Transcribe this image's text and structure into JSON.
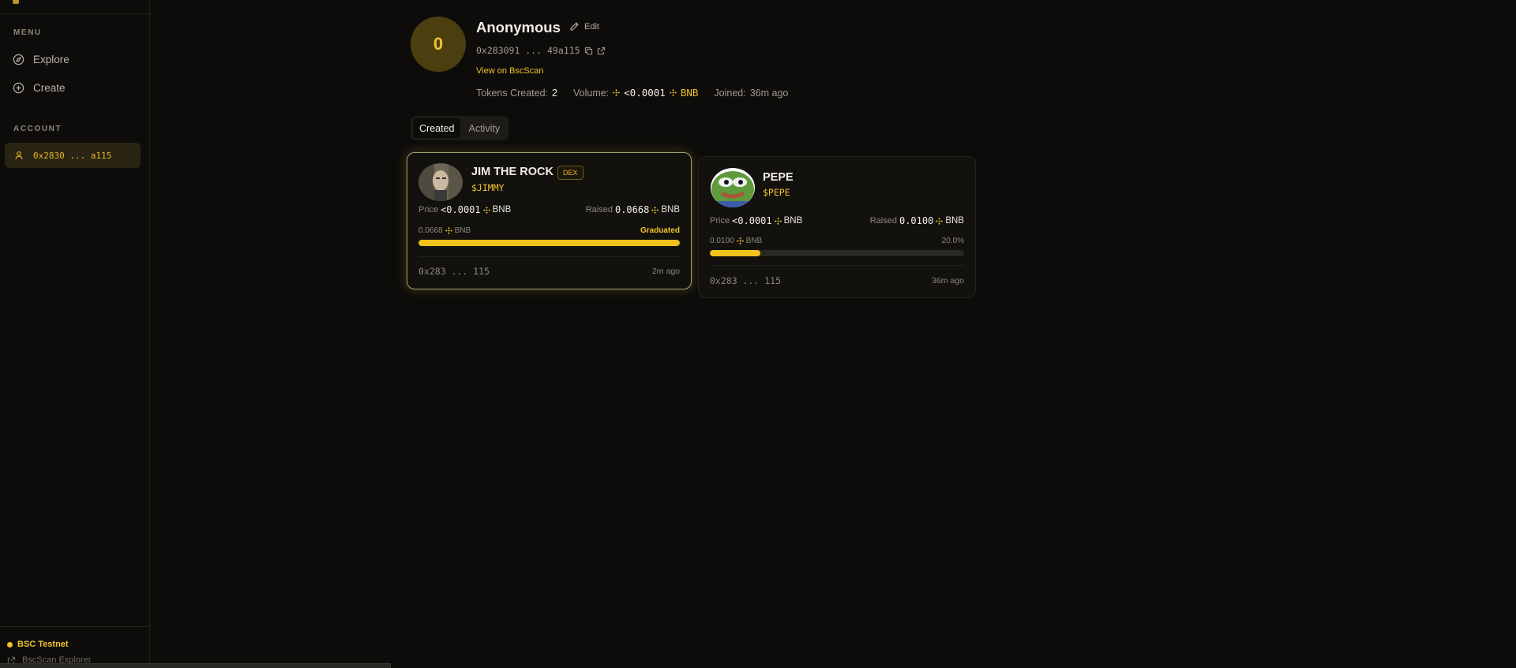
{
  "sidebar": {
    "menu_label": "MENU",
    "items": [
      {
        "label": "Explore",
        "icon": "compass-icon"
      },
      {
        "label": "Create",
        "icon": "plus-circle-icon"
      }
    ],
    "account_label": "ACCOUNT",
    "account": {
      "label": "0x2830 ... a115",
      "icon": "user-icon"
    },
    "network": {
      "label": "BSC Testnet",
      "status_color": "#f0c22b"
    },
    "explorer_link": "BscScan Explorer"
  },
  "profile": {
    "avatar_text": "0",
    "name": "Anonymous",
    "edit_label": "Edit",
    "address": "0x283091 ... 49a115",
    "bscscan_label": "View on BscScan",
    "stats": {
      "tokens_created_label": "Tokens Created:",
      "tokens_created_value": "2",
      "volume_label": "Volume:",
      "volume_value": "<0.0001",
      "volume_unit": "BNB",
      "joined_label": "Joined:",
      "joined_value": "36m ago"
    }
  },
  "tabs": [
    {
      "label": "Created",
      "active": true
    },
    {
      "label": "Activity",
      "active": false
    }
  ],
  "tokens": [
    {
      "name": "JIM THE ROCK",
      "ticker": "$JIMMY",
      "badge": "DEX",
      "price_label": "Price",
      "price_value": "<0.0001",
      "price_unit": "BNB",
      "raised_label": "Raised",
      "raised_value": "0.0668",
      "raised_unit": "BNB",
      "progress_amount": "0.0668",
      "progress_unit": "BNB",
      "progress_status": "Graduated",
      "progress_fraction": 1.0,
      "creator": "0x283 ... 115",
      "age": "2m ago"
    },
    {
      "name": "PEPE",
      "ticker": "$PEPE",
      "price_label": "Price",
      "price_value": "<0.0001",
      "price_unit": "BNB",
      "raised_label": "Raised",
      "raised_value": "0.0100",
      "raised_unit": "BNB",
      "progress_amount": "0.0100",
      "progress_unit": "BNB",
      "progress_status": "20.0%",
      "progress_fraction": 0.2,
      "creator": "0x283 ... 115",
      "age": "36m ago"
    }
  ],
  "colors": {
    "accent": "#f0c22b",
    "background": "#0d0c0a",
    "card": "#12110e"
  }
}
